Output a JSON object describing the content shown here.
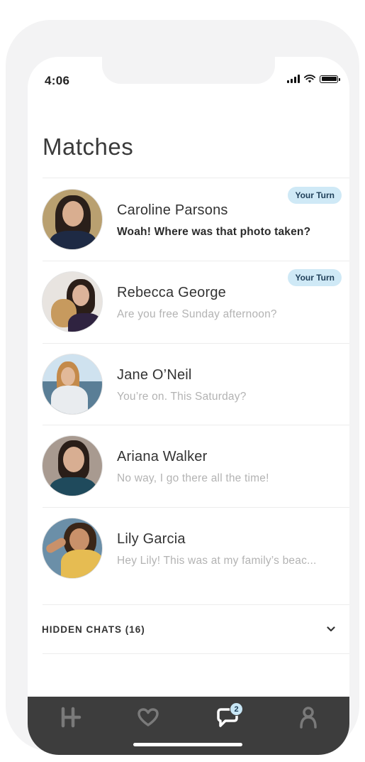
{
  "status_bar": {
    "time": "4:06"
  },
  "header": {
    "title": "Matches"
  },
  "matches": [
    {
      "name": "Caroline Parsons",
      "message": "Woah! Where was that photo taken?",
      "unread": true,
      "badge": "Your Turn"
    },
    {
      "name": "Rebecca George",
      "message": "Are you free Sunday afternoon?",
      "unread": false,
      "badge": "Your Turn"
    },
    {
      "name": "Jane O’Neil",
      "message": "You’re on. This Saturday?",
      "unread": false,
      "badge": ""
    },
    {
      "name": "Ariana Walker",
      "message": "No way, I go there all the time!",
      "unread": false,
      "badge": ""
    },
    {
      "name": "Lily Garcia",
      "message": "Hey Lily! This was at my family’s beac...",
      "unread": false,
      "badge": ""
    }
  ],
  "hidden_chats": {
    "label": "HIDDEN CHATS (16)"
  },
  "tabbar": {
    "tabs": [
      {
        "icon": "hinge-logo-icon",
        "active": false
      },
      {
        "icon": "heart-icon",
        "active": false
      },
      {
        "icon": "chat-icon",
        "active": true,
        "badge": "2"
      },
      {
        "icon": "profile-icon",
        "active": false
      }
    ]
  },
  "colors": {
    "badge_bg": "#cfe9f6",
    "badge_text": "#1e3e58",
    "tabbar_bg": "#3d3d3d",
    "inactive_icon": "#7a7a7a"
  }
}
